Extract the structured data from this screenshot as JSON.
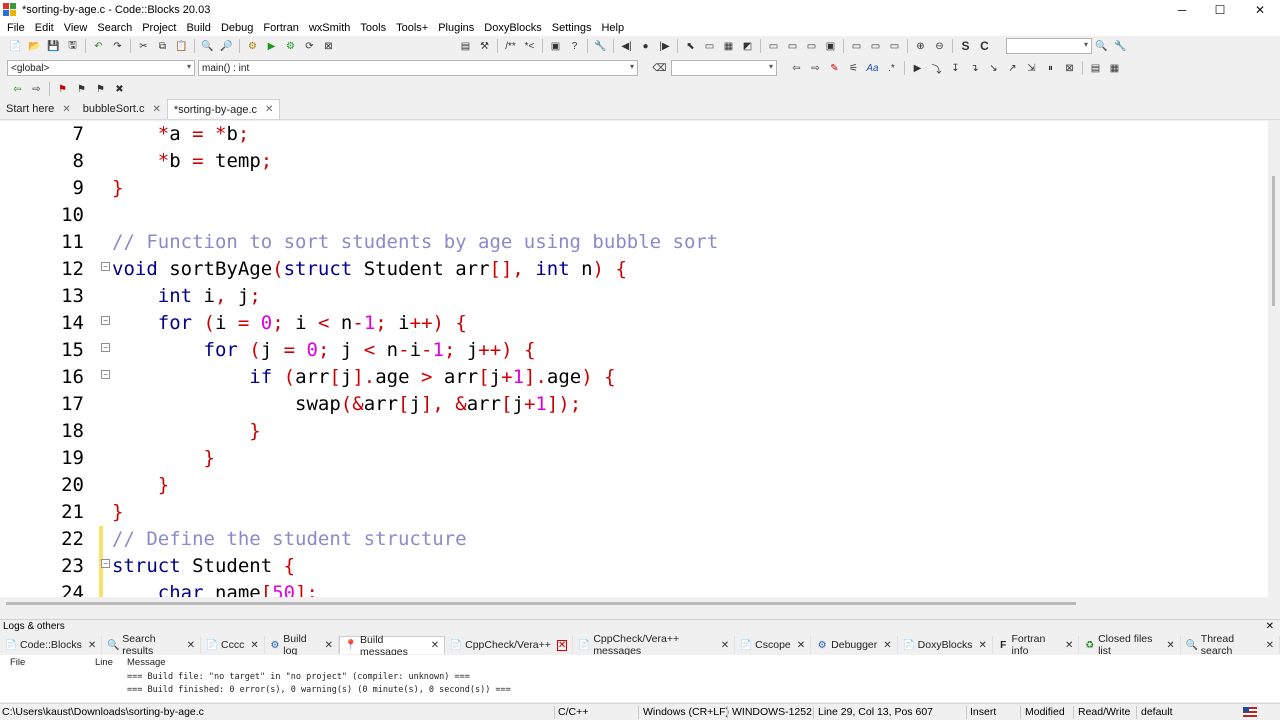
{
  "window": {
    "title": "*sorting-by-age.c - Code::Blocks 20.03",
    "minimize": "─",
    "maximize": "☐",
    "close": "✕"
  },
  "menu": [
    "File",
    "Edit",
    "View",
    "Search",
    "Project",
    "Build",
    "Debug",
    "Fortran",
    "wxSmith",
    "Tools",
    "Tools+",
    "Plugins",
    "DoxyBlocks",
    "Settings",
    "Help"
  ],
  "scope": {
    "global_combo": "<global>",
    "function_combo": "main() : int"
  },
  "editor_tabs": [
    {
      "label": "Start here"
    },
    {
      "label": "bubbleSort.c"
    },
    {
      "label": "*sorting-by-age.c"
    }
  ],
  "code_lines": [
    {
      "n": "7"
    },
    {
      "n": "8"
    },
    {
      "n": "9"
    },
    {
      "n": "10"
    },
    {
      "n": "11"
    },
    {
      "n": "12"
    },
    {
      "n": "13"
    },
    {
      "n": "14"
    },
    {
      "n": "15"
    },
    {
      "n": "16"
    },
    {
      "n": "17"
    },
    {
      "n": "18"
    },
    {
      "n": "19"
    },
    {
      "n": "20"
    },
    {
      "n": "21"
    },
    {
      "n": "22"
    },
    {
      "n": "23"
    },
    {
      "n": "24"
    }
  ],
  "code": {
    "l7": [
      "    ",
      "*",
      "a ",
      "=",
      " ",
      "*",
      "b",
      ";"
    ],
    "l8": [
      "    ",
      "*",
      "b ",
      "=",
      " temp",
      ";"
    ],
    "l9": "}",
    "l11": "// Function to sort students by age using bubble sort",
    "l12": [
      "void",
      " sortByAge",
      "(",
      "struct",
      " Student arr",
      "[]",
      ", ",
      "int",
      " n",
      ")",
      " ",
      "{"
    ],
    "l13": [
      "    ",
      "int",
      " i",
      ",",
      " j",
      ";"
    ],
    "l14": [
      "    ",
      "for",
      " ",
      "(",
      "i ",
      "=",
      " ",
      "0",
      ";",
      " i ",
      "<",
      " n",
      "-",
      "1",
      ";",
      " i",
      "++",
      ")",
      " ",
      "{"
    ],
    "l15": [
      "        ",
      "for",
      " ",
      "(",
      "j ",
      "=",
      " ",
      "0",
      ";",
      " j ",
      "<",
      " n",
      "-",
      "i",
      "-",
      "1",
      ";",
      " j",
      "++",
      ")",
      " ",
      "{"
    ],
    "l16": [
      "            ",
      "if",
      " ",
      "(",
      "arr",
      "[",
      "j",
      "]",
      ".",
      "age ",
      ">",
      " arr",
      "[",
      "j",
      "+",
      "1",
      "]",
      ".",
      "age",
      ")",
      " ",
      "{"
    ],
    "l17": [
      "                swap",
      "(",
      "&",
      "arr",
      "[",
      "j",
      "],",
      " ",
      "&",
      "arr",
      "[",
      "j",
      "+",
      "1",
      "])",
      ";"
    ],
    "l18": "            }",
    "l19": "        }",
    "l20": "    }",
    "l21": "}",
    "l22": "// Define the student structure",
    "l23": [
      "struct",
      " Student ",
      "{"
    ],
    "l24": [
      "    ",
      "char",
      " name",
      "[",
      "50",
      "]",
      ";"
    ]
  },
  "logs": {
    "header": "Logs & others",
    "tabs": [
      "Code::Blocks",
      "Search results",
      "Cccc",
      "Build log",
      "Build messages",
      "CppCheck/Vera++",
      "CppCheck/Vera++ messages",
      "Cscope",
      "Debugger",
      "DoxyBlocks",
      "Fortran info",
      "Closed files list",
      "Thread search"
    ],
    "col_file": "File",
    "col_line": "Line",
    "col_message": "Message",
    "messages": [
      "=== Build file: \"no target\" in \"no project\" (compiler: unknown) ===",
      "=== Build finished: 0 error(s), 0 warning(s) (0 minute(s), 0 second(s)) ==="
    ]
  },
  "status": {
    "path": "C:\\Users\\kaust\\Downloads\\sorting-by-age.c",
    "language": "C/C++",
    "eol": "Windows (CR+LF)",
    "encoding": "WINDOWS-1252",
    "position": "Line 29, Col 13, Pos 607",
    "mode": "Insert",
    "modified": "Modified",
    "access": "Read/Write",
    "profile": "default"
  },
  "colors": {
    "keyword": "#00008b",
    "comment": "#8a8ac8",
    "number": "#e000e0",
    "operator": "#cc0000"
  }
}
